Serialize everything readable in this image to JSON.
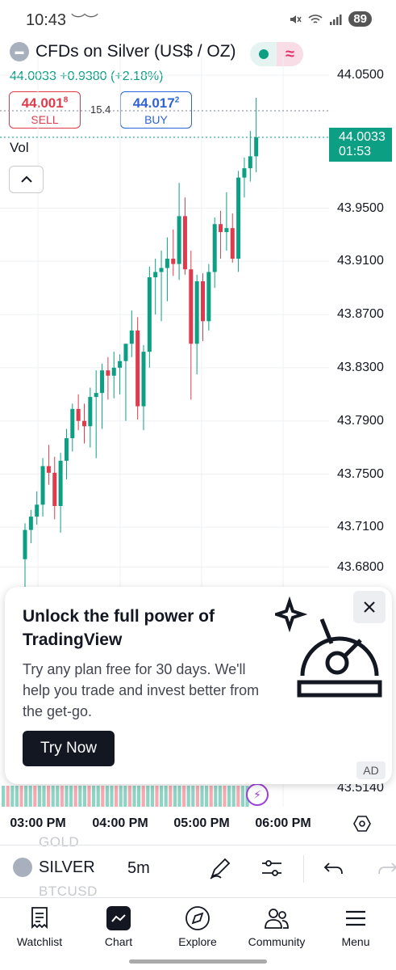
{
  "status_bar": {
    "time": "10:43",
    "battery": "89"
  },
  "header": {
    "title": "CFDs on Silver (US$ / OZ)",
    "last": "44.0033",
    "change": "+0.9380",
    "change_pct": "(+2.18%)"
  },
  "trade": {
    "sell_price": "44.001",
    "sell_sup": "8",
    "sell_label": "SELL",
    "buy_price": "44.017",
    "buy_sup": "2",
    "buy_label": "BUY",
    "spread": "15.4"
  },
  "vol_label": "Vol",
  "price_axis": [
    "44.0500",
    "43.9500",
    "43.9100",
    "43.8700",
    "43.8300",
    "43.7900",
    "43.7500",
    "43.7100",
    "43.6800"
  ],
  "last_price_tag": {
    "price": "44.0033",
    "countdown": "01:53"
  },
  "bottom_price_label": "43.5140",
  "time_axis": [
    "03:00 PM",
    "04:00 PM",
    "05:00 PM",
    "06:00 PM"
  ],
  "ad": {
    "title": "Unlock the full power of TradingView",
    "body": "Try any plan free for 30 days. We'll help you trade and invest better from the get-go.",
    "button": "Try Now",
    "badge": "AD"
  },
  "toolbar": {
    "symbol": "SILVER",
    "interval": "5m",
    "ghost_above": "GOLD",
    "ghost_below": "BTCUSD"
  },
  "nav": [
    "Watchlist",
    "Chart",
    "Explore",
    "Community",
    "Menu"
  ],
  "colors": {
    "up": "#0c9f84",
    "down": "#e03b4c",
    "buy": "#2f63d6"
  },
  "chart_data": {
    "type": "candlestick",
    "interval": "5m",
    "last_price": 44.0033,
    "price_axis_ticks": [
      44.05,
      43.95,
      43.91,
      43.87,
      43.83,
      43.79,
      43.75,
      43.71,
      43.68
    ],
    "time_ticks": [
      "03:00 PM",
      "04:00 PM",
      "05:00 PM",
      "06:00 PM"
    ],
    "candles": [
      [
        43.686,
        43.713,
        43.662,
        43.708
      ],
      [
        43.708,
        43.723,
        43.698,
        43.718
      ],
      [
        43.718,
        43.737,
        43.712,
        43.727
      ],
      [
        43.727,
        43.762,
        43.718,
        43.756
      ],
      [
        43.756,
        43.772,
        43.742,
        43.751
      ],
      [
        43.751,
        43.763,
        43.716,
        43.726
      ],
      [
        43.726,
        43.766,
        43.706,
        43.76
      ],
      [
        43.76,
        43.784,
        43.746,
        43.777
      ],
      [
        43.777,
        43.803,
        43.767,
        43.799
      ],
      [
        43.799,
        43.81,
        43.783,
        43.79
      ],
      [
        43.79,
        43.803,
        43.773,
        43.786
      ],
      [
        43.786,
        43.815,
        43.77,
        43.808
      ],
      [
        43.808,
        43.828,
        43.762,
        43.811
      ],
      [
        43.811,
        43.833,
        43.784,
        43.828
      ],
      [
        43.828,
        43.838,
        43.806,
        43.824
      ],
      [
        43.824,
        43.842,
        43.807,
        43.83
      ],
      [
        43.83,
        43.84,
        43.81,
        43.835
      ],
      [
        43.835,
        43.848,
        43.79,
        43.848
      ],
      [
        43.848,
        43.873,
        43.838,
        43.858
      ],
      [
        43.858,
        43.868,
        43.791,
        43.801
      ],
      [
        43.801,
        43.847,
        43.783,
        43.842
      ],
      [
        43.842,
        43.906,
        43.83,
        43.898
      ],
      [
        43.898,
        43.912,
        43.87,
        43.902
      ],
      [
        43.902,
        43.918,
        43.865,
        43.905
      ],
      [
        43.905,
        43.928,
        43.88,
        43.912
      ],
      [
        43.912,
        43.934,
        43.899,
        43.908
      ],
      [
        43.908,
        43.969,
        43.896,
        43.944
      ],
      [
        43.944,
        43.958,
        43.9,
        43.904
      ],
      [
        43.904,
        43.918,
        43.806,
        43.848
      ],
      [
        43.848,
        43.9,
        43.825,
        43.895
      ],
      [
        43.895,
        43.901,
        43.85,
        43.865
      ],
      [
        43.865,
        43.908,
        43.858,
        43.902
      ],
      [
        43.902,
        43.943,
        43.89,
        43.938
      ],
      [
        43.938,
        43.948,
        43.912,
        43.932
      ],
      [
        43.932,
        43.962,
        43.918,
        43.935
      ],
      [
        43.935,
        43.946,
        43.909,
        43.912
      ],
      [
        43.912,
        43.978,
        43.902,
        43.973
      ],
      [
        43.973,
        43.988,
        43.958,
        43.98
      ],
      [
        43.98,
        44.008,
        43.97,
        43.989
      ],
      [
        43.989,
        44.033,
        43.977,
        44.0033
      ]
    ]
  }
}
